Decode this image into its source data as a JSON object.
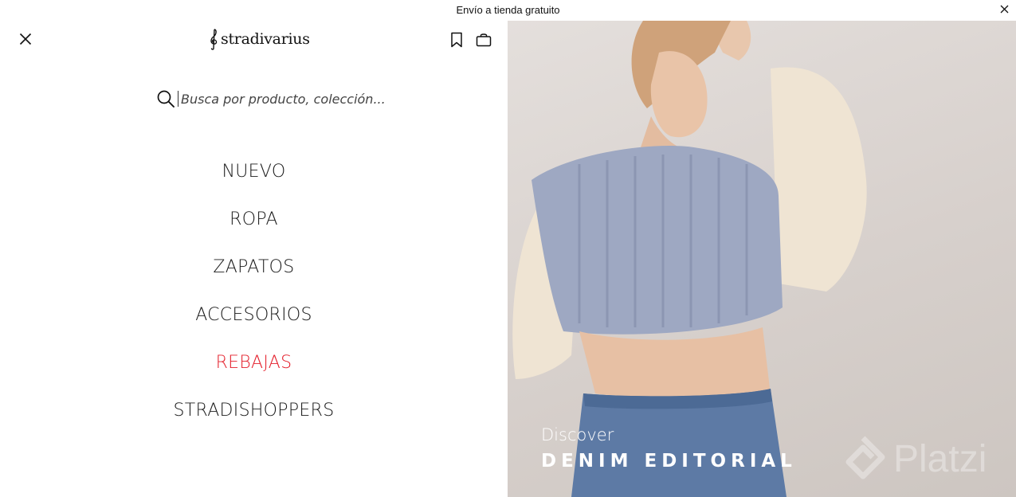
{
  "promo": {
    "text": "Envío a tienda gratuito"
  },
  "header": {
    "brand": "stradivarius"
  },
  "search": {
    "placeholder": "Busca por producto, colección..."
  },
  "nav": {
    "items": [
      {
        "label": "NUEVO"
      },
      {
        "label": "ROPA"
      },
      {
        "label": "ZAPATOS"
      },
      {
        "label": "ACCESORIOS"
      },
      {
        "label": "REBAJAS",
        "highlight": true
      },
      {
        "label": "STRADISHOPPERS"
      }
    ]
  },
  "hero": {
    "kicker": "Discover",
    "title": "DENIM EDITORIAL",
    "watermark": "Platzi"
  },
  "colors": {
    "sale": "#e4202c",
    "text": "#1a1a1a",
    "background": "#ffffff"
  },
  "icons": [
    "close-icon",
    "bookmark-icon",
    "shopping-bag-icon",
    "search-icon",
    "treble-clef-logo-icon"
  ]
}
